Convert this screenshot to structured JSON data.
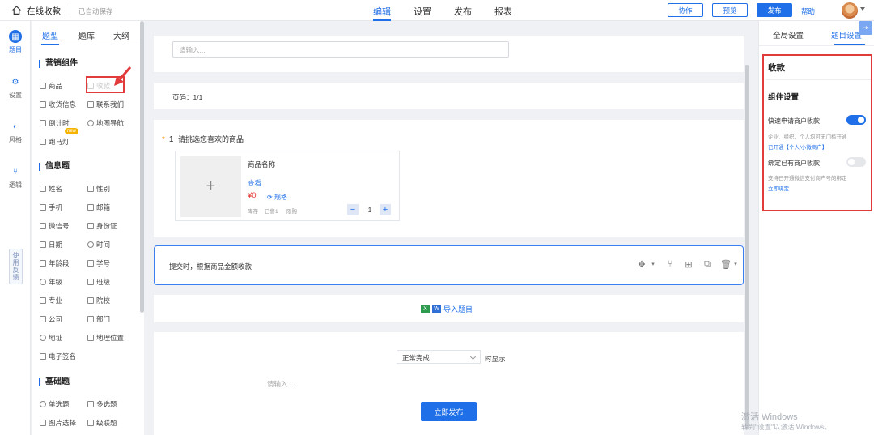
{
  "header": {
    "app_title": "在线收款",
    "autosave": "已自动保存",
    "nav_tabs": [
      "编辑",
      "设置",
      "发布",
      "报表"
    ],
    "buttons": {
      "collab": "协作",
      "preview": "预览",
      "publish": "发布",
      "help": "帮助"
    }
  },
  "rail": {
    "items": [
      "题目",
      "设置",
      "风格",
      "逻辑"
    ],
    "feedback": "使用反馈"
  },
  "panel": {
    "tabs": [
      "题型",
      "题库",
      "大纲"
    ],
    "sections": {
      "marketing": {
        "title": "营销组件",
        "items": [
          "商品",
          "收款",
          "收货信息",
          "联系我们",
          "倒计时",
          "地图导航",
          "跑马灯"
        ],
        "new_badge": "new"
      },
      "info": {
        "title": "信息题",
        "items": [
          "姓名",
          "性别",
          "手机",
          "邮箱",
          "微信号",
          "身份证",
          "日期",
          "时间",
          "年龄段",
          "学号",
          "年级",
          "班级",
          "专业",
          "院校",
          "公司",
          "部门",
          "地址",
          "地理位置",
          "电子签名"
        ]
      },
      "basic": {
        "title": "基础题",
        "items": [
          "单选题",
          "多选题",
          "图片选择",
          "级联题"
        ]
      }
    }
  },
  "canvas": {
    "title_placeholder": "请输入...",
    "page_label": "页码：1/1",
    "question": {
      "number": "1",
      "text": "请挑选您喜欢的商品",
      "product": {
        "name": "商品名称",
        "view": "查看",
        "price": "¥0",
        "spec": "规格",
        "meta1": "库存",
        "meta2": "已售1",
        "meta3": "限购",
        "quantity": "1"
      }
    },
    "submit_text": "提交时，根据商品金额收款",
    "import_text": "导入题目",
    "end": {
      "select_value": "正常完成",
      "show_text": "时显示",
      "input_placeholder": "请输入...",
      "publish_button": "立即发布"
    }
  },
  "right_panel": {
    "tabs": [
      "全局设置",
      "题目设置"
    ],
    "title": "收款",
    "subtitle": "组件设置",
    "settings": [
      {
        "label": "快速申请商户收款",
        "on": true,
        "hint": "企业、组织、个人均可无门槛开通",
        "link": "已开通【个人/小微商户】"
      },
      {
        "label": "绑定已有商户收款",
        "on": false,
        "hint": "支持已开通微信支付商户号的绑定",
        "link": "立即绑定"
      }
    ]
  },
  "watermark": {
    "line1": "激活 Windows",
    "line2": "转到\"设置\"以激活 Windows。"
  }
}
